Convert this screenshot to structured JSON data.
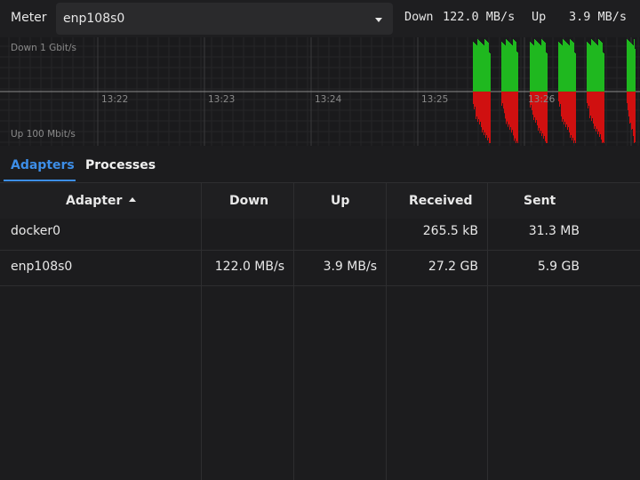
{
  "header": {
    "meter_label": "Meter",
    "adapter_selected": "enp108s0",
    "down_label": "Down",
    "down_value": "122.0 MB/s",
    "up_label": "Up",
    "up_value": "3.9 MB/s"
  },
  "graph": {
    "down_scale_label": "Down 1 Gbit/s",
    "up_scale_label": "Up 100 Mbit/s",
    "time_labels": [
      "13:22",
      "13:23",
      "13:24",
      "13:25",
      "13:26"
    ],
    "down_color": "#1fb81f",
    "up_color": "#d01010"
  },
  "tabs": [
    {
      "label": "Adapters",
      "active": true
    },
    {
      "label": "Processes",
      "active": false
    }
  ],
  "table": {
    "columns": [
      "Adapter",
      "Down",
      "Up",
      "Received",
      "Sent"
    ],
    "sort_column": "Adapter",
    "rows": [
      {
        "adapter": "docker0",
        "down": "",
        "up": "",
        "received": "265.5 kB",
        "sent": "31.3 MB"
      },
      {
        "adapter": "enp108s0",
        "down": "122.0 MB/s",
        "up": "3.9 MB/s",
        "received": "27.2 GB",
        "sent": "5.9 GB"
      }
    ]
  },
  "colors": {
    "accent": "#3d8ee8"
  }
}
